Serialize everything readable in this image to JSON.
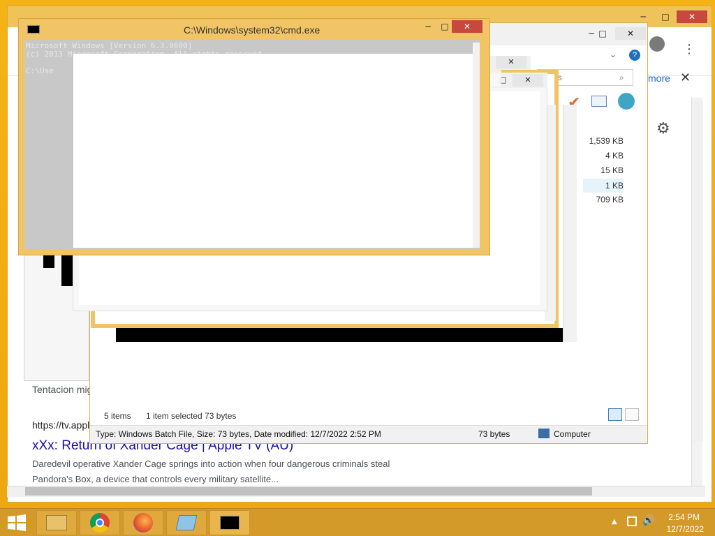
{
  "browser": {
    "more_label": "more",
    "results": [
      {
        "snippet_prefix": "Tentacion mig"
      },
      {
        "url_prefix": "https://tv.appl"
      },
      {
        "title": "xXx: Return of Xander Cage | Apple TV (AU)",
        "line1": "Daredevil operative Xander Cage springs into action when four dangerous criminals steal",
        "line2": "Pandora's Box, a device that controls every military satellite..."
      }
    ]
  },
  "explorer": {
    "search_placeholder": "loads",
    "sizes": [
      "1,539 KB",
      "4 KB",
      "15 KB",
      "1 KB",
      "709 KB"
    ],
    "status": {
      "items": "5 items",
      "selected": "1 item selected  73 bytes"
    },
    "details": {
      "info": "Type: Windows Batch File, Size: 73 bytes, Date modified: 12/7/2022 2:52 PM",
      "size": "73 bytes",
      "location": "Computer"
    }
  },
  "cmd": {
    "title": "C:\\Windows\\system32\\cmd.exe",
    "line1": "Microsoft Windows [Version 6.3.9600]",
    "line2": "(c) 2013 Microsoft Corporation. All rights reserved.",
    "line3": "C:\\Use"
  },
  "taskbar": {
    "time": "2:54 PM",
    "date": "12/7/2022"
  },
  "colors": {
    "desktop": "#f3b21b",
    "taskbar": "#d39a2a",
    "close_button": "#c7483c"
  }
}
